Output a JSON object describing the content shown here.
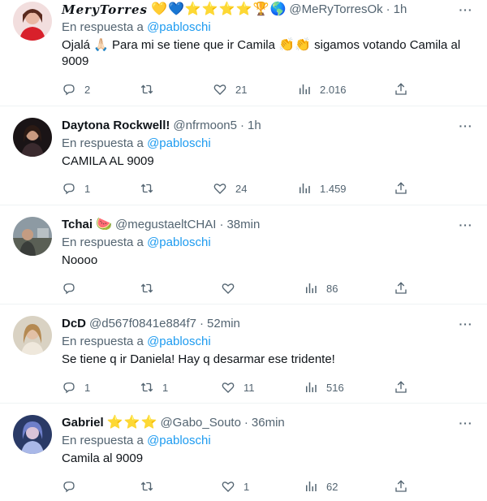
{
  "colors": {
    "link": "#1d9bf0",
    "muted": "#536471",
    "text": "#0f1419",
    "divider": "#eff3f4"
  },
  "replies": [
    {
      "name": "MeryTorres",
      "emoji_badges": [
        "💛",
        "💙",
        "⭐",
        "⭐",
        "⭐",
        "⭐",
        "🏆",
        "🌎"
      ],
      "handle": "@MeRyTorresOk",
      "dot": "·",
      "time": "1h",
      "reply_prefix": "En respuesta a",
      "reply_to": "@pabloschi",
      "text_parts": [
        "Ojalá 🙏🏻 Para mi se tiene que ir Camila ",
        "👏",
        "👏",
        " sigamos votando Camila al 9009"
      ],
      "replies_count": "2",
      "retweets_count": "",
      "likes_count": "21",
      "views_count": "2.016"
    },
    {
      "name": "Daytona Rockwell!",
      "handle": "@nfrmoon5",
      "dot": "·",
      "time": "1h",
      "reply_prefix": "En respuesta a",
      "reply_to": "@pabloschi",
      "text": "CAMILA AL 9009",
      "replies_count": "1",
      "retweets_count": "",
      "likes_count": "24",
      "views_count": "1.459"
    },
    {
      "name": "Tchai",
      "name_emoji": "🍉",
      "handle": "@megustaeltCHAI",
      "dot": "·",
      "time": "38min",
      "reply_prefix": "En respuesta a",
      "reply_to": "@pabloschi",
      "text": "Noooo",
      "replies_count": "",
      "retweets_count": "",
      "likes_count": "",
      "views_count": "86"
    },
    {
      "name": "DcD",
      "handle": "@d567f0841e884f7",
      "dot": "·",
      "time": "52min",
      "reply_prefix": "En respuesta a",
      "reply_to": "@pabloschi",
      "text": "Se tiene q ir Daniela! Hay q desarmar ese tridente!",
      "replies_count": "1",
      "retweets_count": "1",
      "likes_count": "11",
      "views_count": "516"
    },
    {
      "name": "Gabriel",
      "emoji_badges": [
        "⭐",
        "⭐",
        "⭐"
      ],
      "handle": "@Gabo_Souto",
      "dot": "·",
      "time": "36min",
      "reply_prefix": "En respuesta a",
      "reply_to": "@pabloschi",
      "text": "Camila al 9009",
      "replies_count": "",
      "retweets_count": "",
      "likes_count": "1",
      "views_count": "62"
    }
  ],
  "icons": {
    "reply": "reply-icon",
    "retweet": "retweet-icon",
    "like": "heart-icon",
    "views": "views-icon",
    "share": "share-icon",
    "more": "more-icon"
  }
}
